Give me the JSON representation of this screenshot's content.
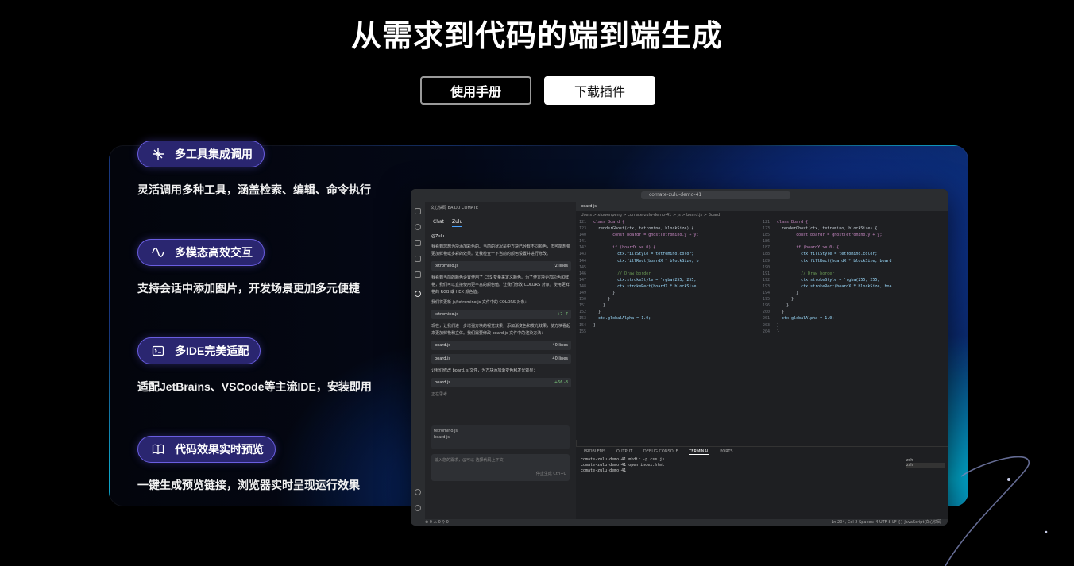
{
  "hero": {
    "title": "从需求到代码的端到端生成",
    "manual_button": "使用手册",
    "download_button": "下载插件"
  },
  "features": [
    {
      "icon": "tools-icon",
      "title": "多工具集成调用",
      "desc": "灵活调用多种工具，涵盖检索、编辑、命令执行"
    },
    {
      "icon": "wave-icon",
      "title": "多模态高效交互",
      "desc": "支持会话中添加图片，开发场景更加多元便捷"
    },
    {
      "icon": "ide-icon",
      "title": "多IDE完美适配",
      "desc": "适配JetBrains、VSCode等主流IDE，安装即用"
    },
    {
      "icon": "book-icon",
      "title": "代码效果实时预览",
      "desc": "一键生成预览链接，浏览器实时呈现运行效果"
    }
  ],
  "ide": {
    "search": "comate-zulu-demo-41",
    "chat_header": "文心快码 BAIDU COMATE",
    "chat_tabs": [
      "Chat",
      "Zulu"
    ],
    "chat_agent": "@Zulu",
    "chat_para1": "我看到您想为块添加彩色的、当前的状况是中方块已经有不同颜色，但可能想要更加鲜艳或多彩的效果。让我检查一下当前的颜色设置并进行修改。",
    "chat_file1": "tetromino.js",
    "chat_file1_meta": "/2 lines",
    "chat_para2": "我看到当前的颜色设置使用了 CSS 变量来定义颜色。为了使方块更加彩色和鲜艳，我们可以直接使用更丰富的颜色值。让我们修改 COLORS 对象，使用更鲜艳的 RGB 或 HEX 颜色值。",
    "chat_para3": "我们将更新 js/tetromino.js 文件中的 COLORS 对象：",
    "chat_file2_meta": "+7 -7",
    "chat_para4": "现在，让我们进一步增强方块的视觉效果，添加渐变色和发光效果，使方块看起来更加鲜艳和立体。我们需要修改 board.js 文件中的渲染方法：",
    "chat_file3": "board.js",
    "chat_file3_meta": "40 lines",
    "chat_file4_meta": "40 lines",
    "chat_para5": "让我们修改 board.js 文件，为方块添加渐变色和发光效果：",
    "chat_file5_meta": "+66 -8",
    "chat_running": "正在思考",
    "chat_files": [
      "tetromino.js",
      "board.js"
    ],
    "chat_input_placeholder": "输入您的需求，@可以 选择代码上下文",
    "chat_stop": "停止生成 Ctrl+C",
    "editor_tab": "board.js",
    "breadcrumb": "Users > xiuwenpeng > comate-zulu-demo-41 > js > board.js > Board",
    "code_lines": [
      [
        "121",
        "class Board {"
      ],
      [
        "123",
        "  renderGhost(ctx, tetromino, blockSize) {"
      ],
      [
        "140",
        "        const boardY = ghostTetromino.y + y;"
      ],
      [
        "141",
        ""
      ],
      [
        "142",
        "        if (boardY >= 0) {"
      ],
      [
        "143",
        "          ctx.fillStyle = tetromino.color;"
      ],
      [
        "144",
        "          ctx.fillRect(boardX * blockSize, b"
      ],
      [
        "145",
        ""
      ],
      [
        "146",
        "          // Draw border"
      ],
      [
        "147",
        "          ctx.strokeStyle = 'rgba(255, 255,"
      ],
      [
        "148",
        "          ctx.strokeRect(boardX * blockSize,"
      ],
      [
        "149",
        "        }"
      ],
      [
        "150",
        "      }"
      ],
      [
        "151",
        "    }"
      ],
      [
        "152",
        "  }"
      ],
      [
        "153",
        "  ctx.globalAlpha = 1.0;"
      ],
      [
        "154",
        "}"
      ],
      [
        "155",
        ""
      ]
    ],
    "right_code_lines": [
      [
        "121",
        "class Board {"
      ],
      [
        "123",
        "  renderGhost(ctx, tetromino, blockSize) {"
      ],
      [
        "185",
        "        const boardY = ghostTetromino.y + y;"
      ],
      [
        "186",
        ""
      ],
      [
        "187",
        "        if (boardY >= 0) {"
      ],
      [
        "188",
        "          ctx.fillStyle = tetromino.color;"
      ],
      [
        "189",
        "          ctx.fillRect(boardX * blockSize, board"
      ],
      [
        "190",
        ""
      ],
      [
        "191",
        "          // Draw border"
      ],
      [
        "192",
        "          ctx.strokeStyle = 'rgba(255, 255,"
      ],
      [
        "193",
        "          ctx.strokeRect(boardX * blockSize, boa"
      ],
      [
        "194",
        "        }"
      ],
      [
        "195",
        "      }"
      ],
      [
        "196",
        "    }"
      ],
      [
        "200",
        "  }"
      ],
      [
        "201",
        "  ctx.globalAlpha = 1.0;"
      ],
      [
        "203",
        "}"
      ],
      [
        "204",
        "}"
      ]
    ],
    "terminal_tabs": [
      "PROBLEMS",
      "OUTPUT",
      "DEBUG CONSOLE",
      "TERMINAL",
      "PORTS"
    ],
    "terminal_lines": [
      "comate-zulu-demo-41 mkdir -p css js",
      "comate-zulu-demo-41 open index.html",
      "comate-zulu-demo-41 "
    ],
    "terminal_side": [
      "zsh",
      "zsh"
    ],
    "status_left": "⊗ 0 ⚠ 0   ⚲ 0",
    "status_right": "Ln 204, Col 2   Spaces: 4   UTF-8   LF   {} JavaScript   文心快码"
  },
  "colors": {
    "accent": "#6a5ee0",
    "pill_bg": "#2a2670",
    "panel_cyan": "#00bedc"
  }
}
